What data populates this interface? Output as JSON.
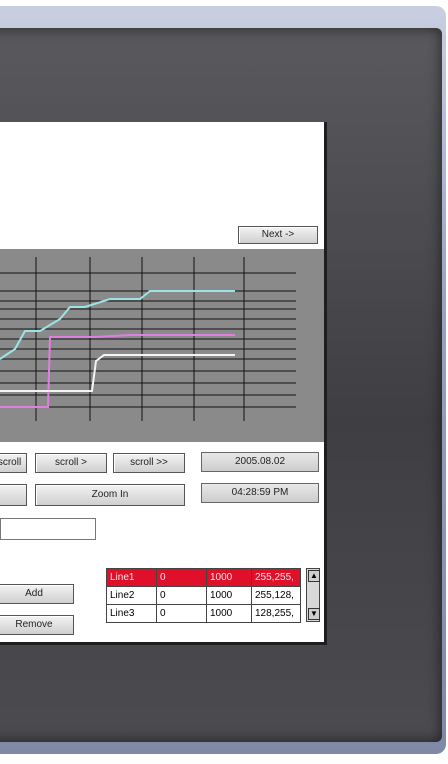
{
  "screen": {
    "next_label": "Next ->",
    "controls": {
      "scroll_left_label": "scroll",
      "scroll_right_label": "scroll >",
      "scroll_far_right_label": "scroll >>",
      "zoom_in_label": "Zoom In",
      "date": "2005.08.02",
      "time": "04:28:59 PM",
      "add_label": "Add",
      "remove_label": "Remove"
    },
    "lines_table": {
      "rows": [
        [
          "Line1",
          "0",
          "1000",
          "255,255,"
        ],
        [
          "Line2",
          "0",
          "1000",
          "255,128,"
        ],
        [
          "Line3",
          "0",
          "1000",
          "128,255,"
        ]
      ],
      "selected_row": 0
    }
  },
  "colors": {
    "chart_background": "#8a8a8a",
    "grid": "#111111",
    "trace_cyan": "#9be3e6",
    "trace_pink": "#e07fe0",
    "trace_white": "#f4f4f4",
    "selection": "#e0102a"
  }
}
